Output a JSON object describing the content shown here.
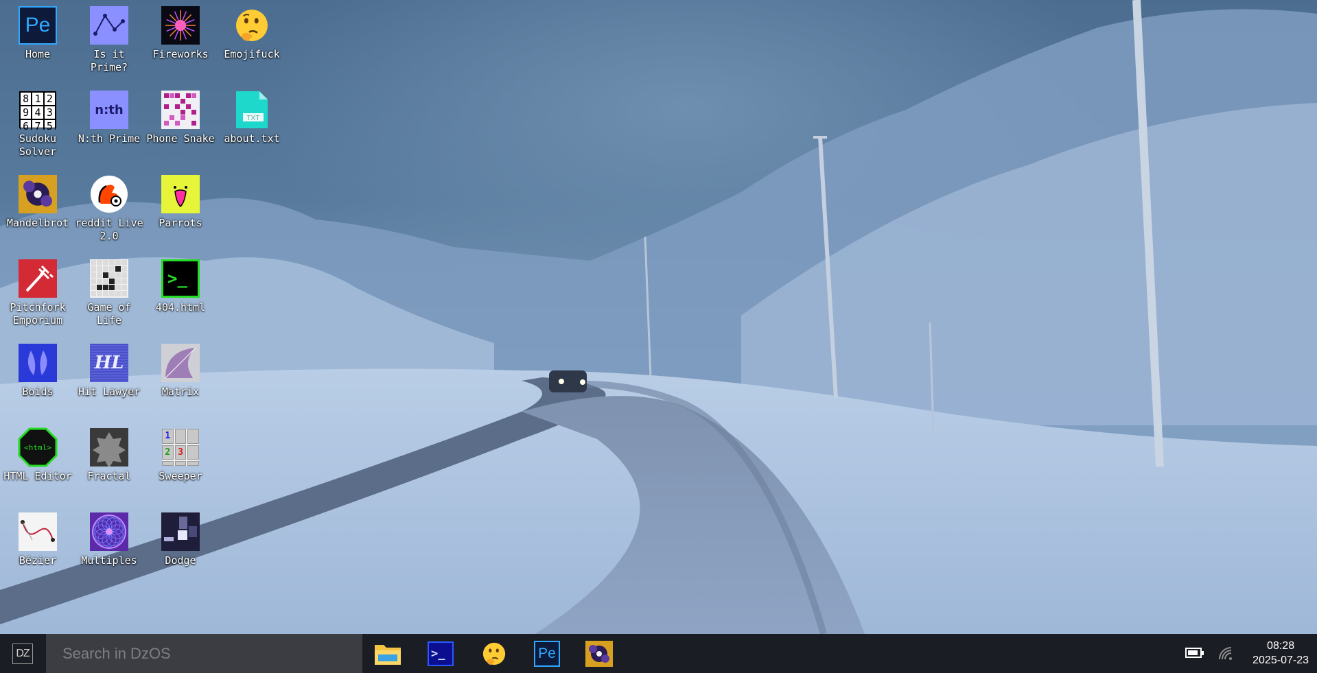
{
  "desktop": {
    "icons": [
      {
        "label": "Home",
        "icon": "pe-icon"
      },
      {
        "label": "Is it Prime?",
        "icon": "graph-icon"
      },
      {
        "label": "Fireworks",
        "icon": "firework-icon"
      },
      {
        "label": "Emojifuck",
        "icon": "thinking-emoji-icon"
      },
      {
        "label": "Sudoku Solver",
        "icon": "sudoku-icon"
      },
      {
        "label": "N:th Prime",
        "icon": "nth-icon"
      },
      {
        "label": "Phone Snake",
        "icon": "snake-icon"
      },
      {
        "label": "about.txt",
        "icon": "txt-file-icon"
      },
      {
        "label": "Mandelbrot",
        "icon": "mandelbrot-icon"
      },
      {
        "label": "reddit Live 2.0",
        "icon": "reddit-icon"
      },
      {
        "label": "Parrots",
        "icon": "parrot-icon"
      },
      {
        "label": "Pitchfork Emporium",
        "icon": "pitchfork-icon"
      },
      {
        "label": "Game of Life",
        "icon": "life-grid-icon"
      },
      {
        "label": "404.html",
        "icon": "terminal-icon"
      },
      {
        "label": "Boids",
        "icon": "boids-icon"
      },
      {
        "label": "Hit Lawyer",
        "icon": "hl-icon"
      },
      {
        "label": "Matrix",
        "icon": "matrix-icon"
      },
      {
        "label": "HTML Editor",
        "icon": "html-icon"
      },
      {
        "label": "Fractal",
        "icon": "fractal-icon"
      },
      {
        "label": "Sweeper",
        "icon": "minesweeper-icon"
      },
      {
        "label": "Bézier",
        "icon": "bezier-icon"
      },
      {
        "label": "Multiples",
        "icon": "multiples-icon"
      },
      {
        "label": "Dodge",
        "icon": "dodge-icon"
      }
    ],
    "txt_badge": "TXT",
    "pe_text": "Pe",
    "nth_text": "n:th",
    "hl_text": "HL",
    "html_text": "<html>",
    "terminal_text": ">_",
    "sudoku_digits": [
      "8",
      "1",
      "2",
      "9",
      "4",
      "3",
      "6",
      "7",
      "5"
    ],
    "sweeper_digits": [
      "1",
      "2",
      "3"
    ]
  },
  "taskbar": {
    "start_label": "DZ",
    "search_placeholder": "Search in DzOS",
    "pinned": [
      "file-explorer-icon",
      "terminal-icon",
      "thinking-emoji-icon",
      "pe-icon",
      "mandelbrot-icon"
    ],
    "pe_text": "Pe",
    "terminal_text": ">_",
    "time": "08:28",
    "date": "2025-07-23"
  },
  "colors": {
    "taskbar_bg": "#1b1d24",
    "search_bg": "#3c3d42",
    "pe_blue": "#31a8ff",
    "terminal_green": "#22dd22",
    "txt_teal": "#1fd8cc",
    "parrot_yellow": "#e6f53a"
  }
}
